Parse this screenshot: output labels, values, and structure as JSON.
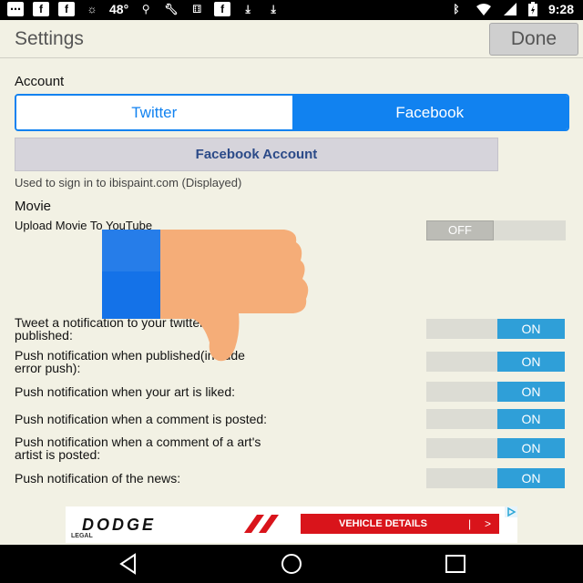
{
  "status_bar": {
    "temperature": "48°",
    "time": "9:28",
    "left_icons": [
      "message-icon",
      "facebook-icon",
      "facebook-icon",
      "weather-icon",
      "temperature-text",
      "biker-icon",
      "wrench-icon",
      "dice-icon",
      "facebook-icon",
      "download-icon",
      "download-icon"
    ],
    "right_icons": [
      "bluetooth-icon",
      "wifi-icon",
      "signal-icon",
      "battery-icon"
    ]
  },
  "header": {
    "title": "Settings",
    "done_label": "Done"
  },
  "account": {
    "section_label": "Account",
    "tabs": [
      {
        "label": "Twitter",
        "selected": false
      },
      {
        "label": "Facebook",
        "selected": true
      }
    ],
    "account_button_label": "Facebook Account",
    "hint": "Used to sign in to ibispaint.com (Displayed)"
  },
  "movie": {
    "section_label": "Movie",
    "upload_label": "Upload Movie To YouTube",
    "upload_toggle": "OFF"
  },
  "notifications": [
    {
      "line1": "Tweet a notification to your twitter when",
      "line2": "published:",
      "state": "ON"
    },
    {
      "line1": "Push notification when published(include",
      "line2": "error push):",
      "state": "ON"
    },
    {
      "line1": "Push notification when your art is liked:",
      "line2": "",
      "state": "ON"
    },
    {
      "line1": "Push notification when a comment is posted:",
      "line2": "",
      "state": "ON"
    },
    {
      "line1": "Push notification when a comment of a art's",
      "line2": "artist is posted:",
      "state": "ON"
    },
    {
      "line1": "Push notification of the news:",
      "line2": "",
      "state": "ON"
    }
  ],
  "overlay": {
    "icon": "thumbs-down-icon",
    "cuff_color": "#1472e8",
    "hand_color": "#f5ad78"
  },
  "ad": {
    "brand": "DODGE",
    "cta": "VEHICLE DETAILS",
    "cta_separator": "|",
    "cta_arrow": ">",
    "legal": "LEGAL",
    "brand_color": "#d9141b"
  },
  "nav": {
    "buttons": [
      "back-icon",
      "home-icon",
      "recents-icon"
    ]
  }
}
